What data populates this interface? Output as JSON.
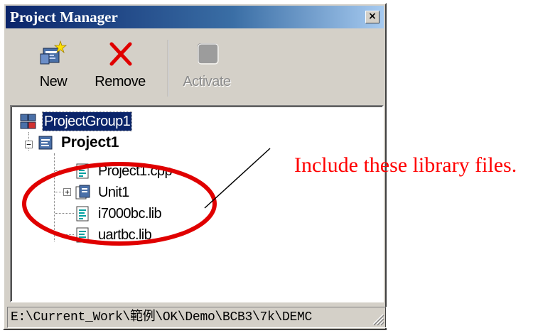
{
  "window": {
    "title": "Project Manager",
    "close_glyph": "×"
  },
  "toolbar": {
    "buttons": [
      {
        "label": "New",
        "icon": "new-project-icon",
        "enabled": true
      },
      {
        "label": "Remove",
        "icon": "remove-icon",
        "enabled": true
      },
      {
        "label": "Activate",
        "icon": "activate-icon",
        "enabled": false
      }
    ]
  },
  "tree": {
    "nodes": [
      {
        "label": "ProjectGroup1",
        "icon": "project-group-icon",
        "selected": true
      },
      {
        "label": "Project1",
        "icon": "project-icon",
        "bold": true,
        "expanded": true
      },
      {
        "label": "Project1.cpp",
        "icon": "source-file-icon"
      },
      {
        "label": "Unit1",
        "icon": "unit-icon",
        "collapsed": true
      },
      {
        "label": "i7000bc.lib",
        "icon": "library-file-icon"
      },
      {
        "label": "uartbc.lib",
        "icon": "library-file-icon"
      }
    ],
    "expander_collapsed": "+",
    "expander_expanded": "−"
  },
  "statusbar": {
    "path": "E:\\Current_Work\\範例\\OK\\Demo\\BCB3\\7k\\DEMC"
  },
  "annotation": {
    "text": "Include these library files.",
    "color": "#ff0000"
  },
  "colors": {
    "title_start": "#0a246a",
    "title_end": "#a6caf0",
    "face": "#d4d0c8",
    "selection": "#0a246a",
    "highlight": "#ff0000"
  }
}
